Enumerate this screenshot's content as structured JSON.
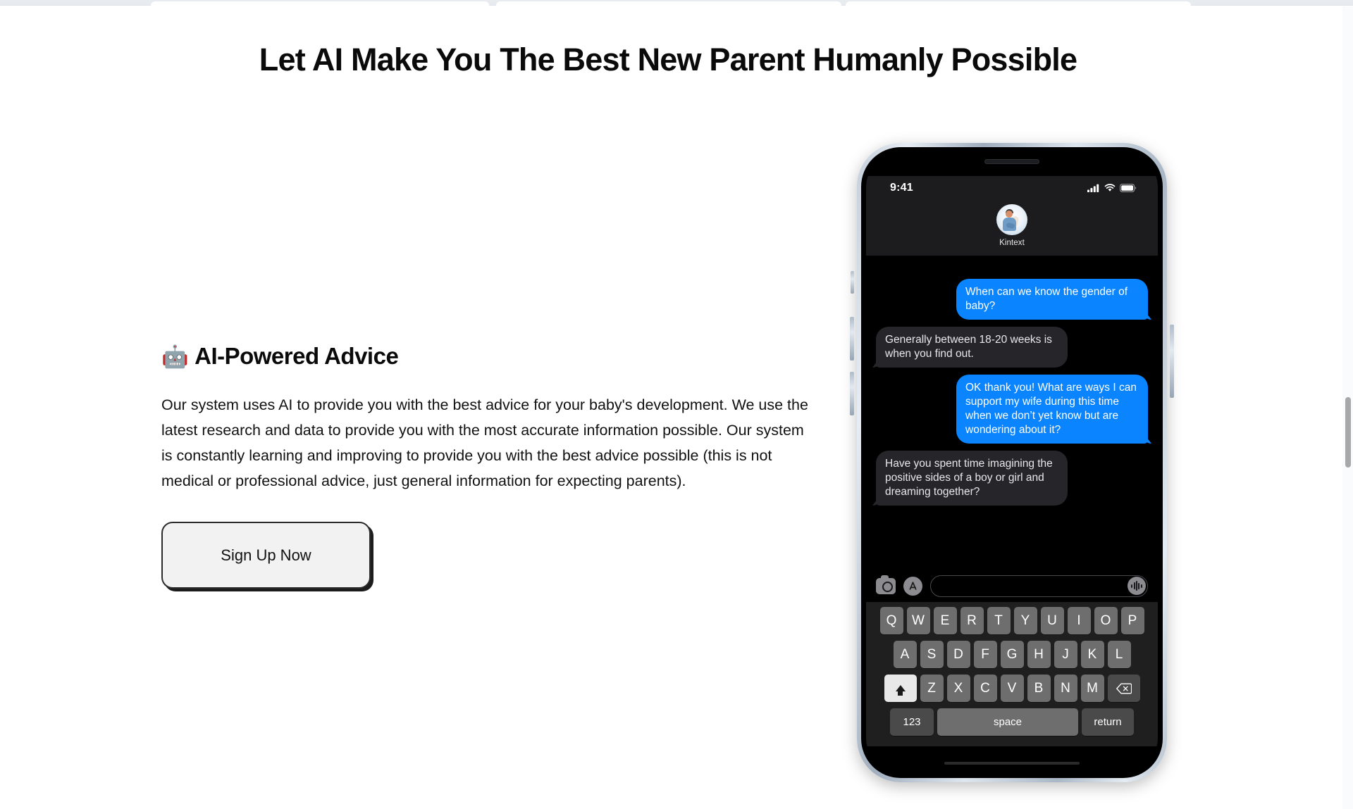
{
  "page": {
    "headline": "Let AI Make You The Best New Parent Humanly Possible"
  },
  "feature": {
    "emoji": "🤖",
    "title": "AI-Powered Advice",
    "body": "Our system uses AI to provide you with the best advice for your baby's development. We use the latest research and data to provide you with the most accurate information possible. Our system is constantly learning and improving to provide you with the best advice possible (this is not medical or professional advice, just general information for expecting parents).",
    "cta_label": "Sign Up Now"
  },
  "phone": {
    "status": {
      "time": "9:41",
      "cellular_icon": "signal-bars-icon",
      "wifi_icon": "wifi-icon",
      "battery_icon": "battery-icon"
    },
    "conversation": {
      "contact_name": "Kintext",
      "avatar_icon": "contact-avatar",
      "messages": [
        {
          "from": "out",
          "text": "When can we know the gender of baby?"
        },
        {
          "from": "in",
          "text": "Generally between 18-20 weeks is when you find out."
        },
        {
          "from": "out",
          "text": "OK thank you! What are ways I can support my wife during this time when we don’t yet know but are wondering about it?"
        },
        {
          "from": "in",
          "text": "Have you spent time imagining the positive sides of a boy or girl and dreaming together?"
        }
      ]
    },
    "input_bar": {
      "camera_icon": "camera-icon",
      "appstore_icon": "app-store-icon",
      "field_placeholder": "",
      "field_value": "",
      "audio_icon": "audio-waveform-icon"
    },
    "keyboard": {
      "row1": [
        "Q",
        "W",
        "E",
        "R",
        "T",
        "Y",
        "U",
        "I",
        "O",
        "P"
      ],
      "row2": [
        "A",
        "S",
        "D",
        "F",
        "G",
        "H",
        "J",
        "K",
        "L"
      ],
      "row3": [
        "Z",
        "X",
        "C",
        "V",
        "B",
        "N",
        "M"
      ],
      "shift_label": "shift-icon",
      "backspace_label": "backspace-icon",
      "numbers_label": "123",
      "space_label": "space",
      "return_label": "return"
    }
  },
  "colors": {
    "outgoing_bubble": "#0a84ff",
    "incoming_bubble": "#26262a",
    "header_bg": "#1c1c1e",
    "cta_bg": "#f2f2f2"
  }
}
